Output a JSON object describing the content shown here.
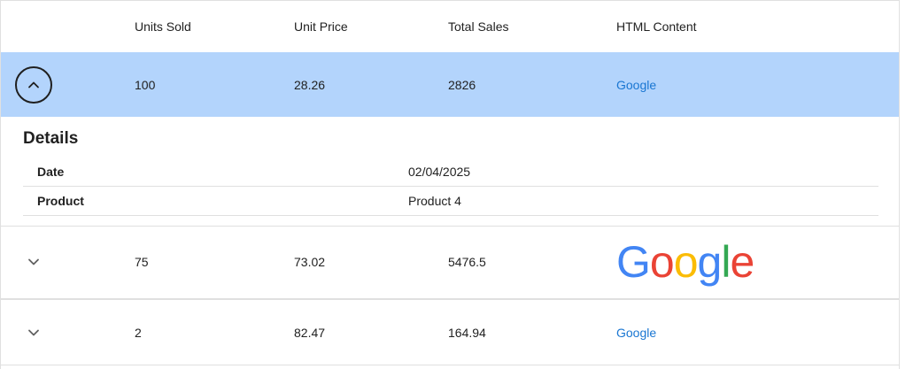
{
  "columns": [
    "Units Sold",
    "Unit Price",
    "Total Sales",
    "HTML Content"
  ],
  "rows": [
    {
      "units": "100",
      "price": "28.26",
      "total": "2826",
      "content": "Google",
      "expanded": true
    },
    {
      "units": "75",
      "price": "73.02",
      "total": "5476.5",
      "content": "Google",
      "content_type": "logo",
      "expanded": false
    },
    {
      "units": "2",
      "price": "82.47",
      "total": "164.94",
      "content": "Google",
      "expanded": false
    }
  ],
  "details": {
    "title": "Details",
    "fields": [
      {
        "label": "Date",
        "value": "02/04/2025"
      },
      {
        "label": "Product",
        "value": "Product 4"
      }
    ]
  },
  "logo_letters": [
    "G",
    "o",
    "o",
    "g",
    "l",
    "e"
  ],
  "colors": {
    "selected_row": "#b3d4fc",
    "link": "#1976d2",
    "logo": [
      "#4285F4",
      "#EA4335",
      "#FBBC05",
      "#4285F4",
      "#34A853",
      "#EA4335"
    ]
  },
  "icons": {
    "expanded": "chevron-up-icon",
    "collapsed": "chevron-down-icon"
  }
}
